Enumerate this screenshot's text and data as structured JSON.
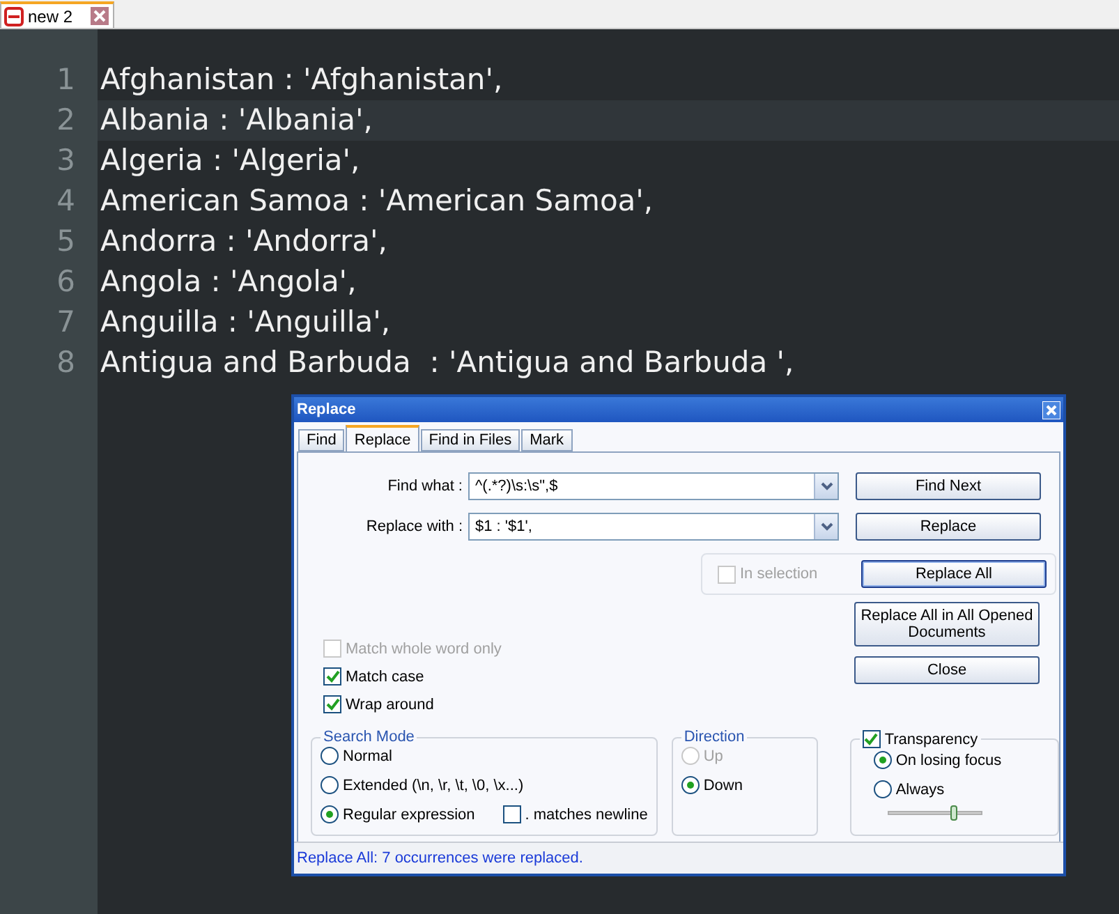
{
  "tab": {
    "title": "new 2"
  },
  "lines": [
    {
      "number": "1",
      "text": "Afghanistan : 'Afghanistan',",
      "current": false
    },
    {
      "number": "2",
      "text": "Albania : 'Albania',",
      "current": true
    },
    {
      "number": "3",
      "text": "Algeria : 'Algeria',",
      "current": false
    },
    {
      "number": "4",
      "text": "American Samoa : 'American Samoa',",
      "current": false
    },
    {
      "number": "5",
      "text": "Andorra : 'Andorra',",
      "current": false
    },
    {
      "number": "6",
      "text": "Angola : 'Angola',",
      "current": false
    },
    {
      "number": "7",
      "text": "Anguilla : 'Anguilla',",
      "current": false
    },
    {
      "number": "8",
      "text": "Antigua and Barbuda  : 'Antigua and Barbuda ',",
      "current": false
    }
  ],
  "dialog": {
    "title": "Replace",
    "tabs": [
      {
        "label": "Find",
        "selected": false
      },
      {
        "label": "Replace",
        "selected": true
      },
      {
        "label": "Find in Files",
        "selected": false
      },
      {
        "label": "Mark",
        "selected": false
      }
    ],
    "fields": [
      {
        "label": "Find what :",
        "value": "^(.*?)\\s:\\s\",$"
      },
      {
        "label": "Replace with :",
        "value": "$1 : '$1',"
      }
    ],
    "buttons": [
      {
        "label": "Find Next",
        "focused": false
      },
      {
        "label": "Replace",
        "focused": false
      },
      {
        "label": "Replace All",
        "focused": true
      },
      {
        "label": "Replace All in All Opened Documents",
        "focused": false
      },
      {
        "label": "Close",
        "focused": false
      }
    ],
    "in_selection": {
      "label": "In selection",
      "checked": false,
      "disabled": true
    },
    "options": [
      {
        "label": "Match whole word only",
        "checked": false,
        "disabled": true
      },
      {
        "label": "Match case",
        "checked": true,
        "disabled": false
      },
      {
        "label": "Wrap around",
        "checked": true,
        "disabled": false
      }
    ],
    "search_mode": {
      "title": "Search Mode",
      "options": [
        {
          "label": "Normal",
          "selected": false
        },
        {
          "label": "Extended (\\n, \\r, \\t, \\0, \\x...)",
          "selected": false
        },
        {
          "label": "Regular expression",
          "selected": true
        }
      ],
      "dot_newline": {
        "label": ". matches newline",
        "checked": false
      }
    },
    "direction": {
      "title": "Direction",
      "options": [
        {
          "label": "Up",
          "selected": false,
          "disabled": true
        },
        {
          "label": "Down",
          "selected": true,
          "disabled": false
        }
      ]
    },
    "transparency": {
      "label": "Transparency",
      "checked": true,
      "options": [
        {
          "label": "On losing focus",
          "selected": true
        },
        {
          "label": "Always",
          "selected": false
        }
      ],
      "level": 0.72
    },
    "status": "Replace All: 7 occurrences were replaced."
  }
}
